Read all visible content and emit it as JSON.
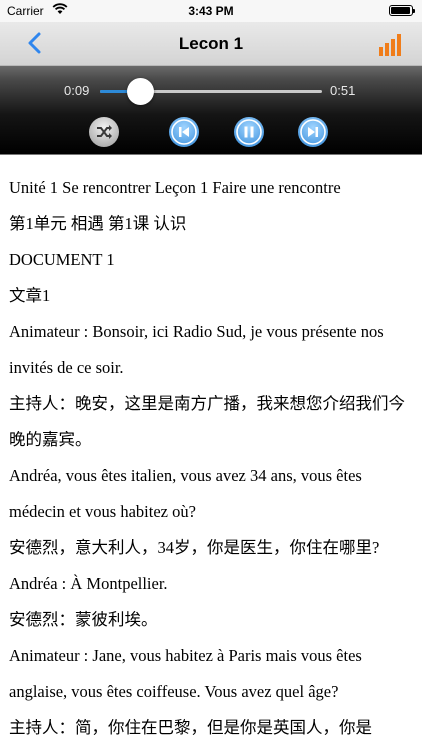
{
  "status_bar": {
    "carrier": "Carrier",
    "time": "3:43 PM"
  },
  "nav": {
    "title": "Lecon 1",
    "back_icon": "chevron-left-icon",
    "chart_icon": "bar-chart-icon",
    "accent": "#2f86ee",
    "chart_color": "#f07d1a"
  },
  "player": {
    "elapsed": "0:09",
    "total": "0:51",
    "progress": 0.18,
    "buttons": [
      "shuffle-icon",
      "previous-icon",
      "pause-icon",
      "next-icon"
    ]
  },
  "lines": [
    "Unité 1 Se rencontrer Leçon 1 Faire une rencontre",
    "第1单元 相遇 第1课 认识",
    "DOCUMENT 1",
    "文章1",
    "Animateur : Bonsoir, ici Radio Sud, je vous présente nos invités de ce soir.",
    "主持人：晚安，这里是南方广播，我来想您介绍我们今晚的嘉宾。",
    "Andréa, vous êtes italien, vous avez 34 ans, vous êtes médecin et vous habitez où?",
    "安德烈，意大利人，34岁，你是医生，你住在哪里?",
    "Andréa : À Montpellier.",
    "安德烈：蒙彼利埃。",
    "Animateur : Jane, vous habitez à Paris mais vous êtes anglaise, vous êtes coiffeuse. Vous avez quel âge?",
    "主持人：简，你住在巴黎，但是你是英国人，你是"
  ]
}
